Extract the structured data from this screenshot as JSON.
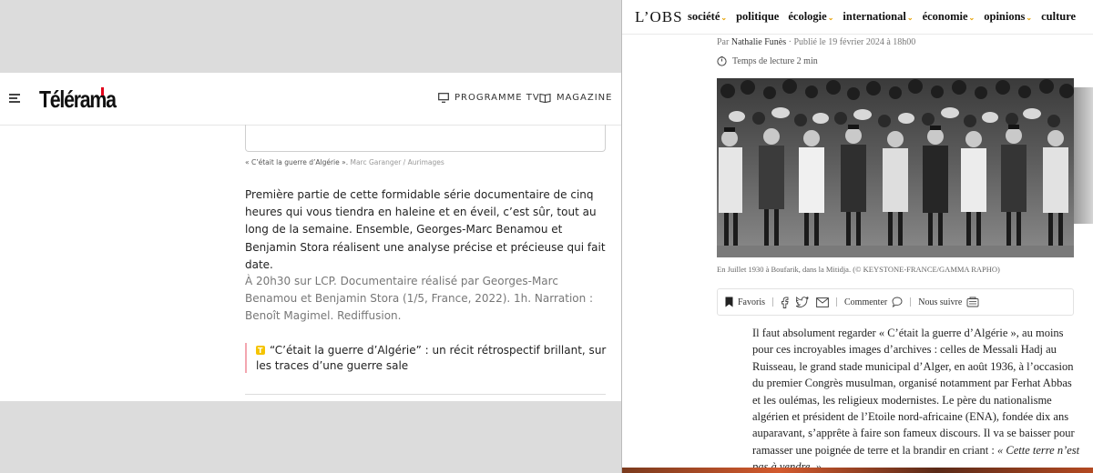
{
  "telerama": {
    "logo": "Télérama",
    "nav": [
      {
        "label": "PROGRAMME TV",
        "icon": "tv-icon"
      },
      {
        "label": "MAGAZINE",
        "icon": "book-icon"
      }
    ],
    "caption_title": "« C’était la guerre d’Algérie ».",
    "caption_credit": "Marc Garanger / Aurimages",
    "paragraph": "Première partie de cette formidable série documentaire de cinq heures qui vous tiendra en haleine et en éveil, c’est sûr, tout au long de la semaine. Ensemble, Georges-Marc Benamou et Benjamin Stora réalisent une analyse précise et précieuse qui fait date.",
    "info": "À 20h30 sur LCP. Documentaire réalisé par Georges-Marc Benamou et Benjamin Stora (1/5, France, 2022). 1h. Narration : Benoît Magimel. Rediffusion.",
    "related_link": "“C’était la guerre d’Algérie” : un récit rétrospectif brillant, sur les traces d’une guerre sale",
    "colors": {
      "accent": "#e2001a",
      "related_border": "#f3a6b0",
      "t_badge": "#f5c400"
    }
  },
  "obs": {
    "logo": "L’OBS",
    "nav": [
      {
        "label": "société",
        "chevron": true
      },
      {
        "label": "politique",
        "chevron": false
      },
      {
        "label": "écologie",
        "chevron": true
      },
      {
        "label": "international",
        "chevron": true
      },
      {
        "label": "économie",
        "chevron": true
      },
      {
        "label": "opinions",
        "chevron": true
      },
      {
        "label": "culture",
        "chevron": false
      }
    ],
    "byline_prefix": "Par",
    "author": "Nathalie Funès",
    "published": "· Publié le 19 février 2024 à 18h00",
    "read_time": "Temps de lecture 2 min",
    "photo_caption": "En Juillet 1930 à Boufarik, dans la Mitidja. (© KEYSTONE-FRANCE/GAMMA RAPHO)",
    "share": {
      "favoris": "Favoris",
      "commenter": "Commenter",
      "nous_suivre": "Nous suivre"
    },
    "article_body": "Il faut absolument regarder « C’était la guerre d’Algérie », au moins pour ces incroyables images d’archives : celles de Messali Hadj au Ruisseau, le grand stade municipal d’Alger, en août 1936, à l’occasion du premier Congrès musulman, organisé notamment par Ferhat Abbas et les oulémas, les religieux modernistes. Le père du nationalisme algérien et président de l’Etoile nord-africaine (ENA), fondée dix ans auparavant, s’apprête à faire son fameux discours. Il va se baisser pour ramasser une poignée de terre et la brandir en criant :",
    "article_quote": "« Cette terre n’est pas à vendre. »",
    "colors": {
      "chevron": "#e6a100"
    }
  }
}
